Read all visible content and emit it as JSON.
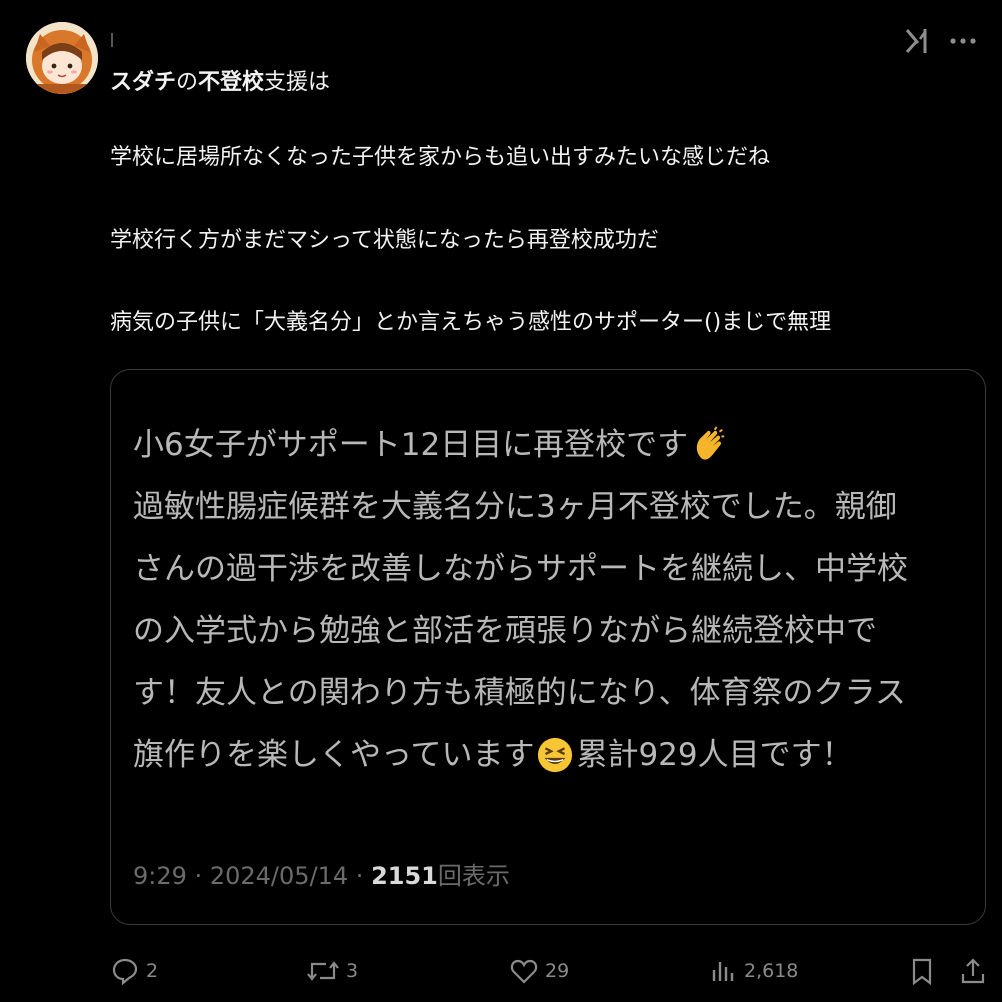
{
  "author": {
    "name_parts": [
      "スダチ",
      "の",
      "不登校",
      "支援は"
    ]
  },
  "post": {
    "lines": [
      "学校に居場所なくなった子供を家からも追い出すみたいな感じだね",
      "学校行く方がまだマシって状態になったら再登校成功だ",
      "病気の子供に「大義名分」とか言えちゃう感性のサポーター()まじで無理"
    ]
  },
  "quote": {
    "lines": [
      {
        "text": "小6女子がサポート12日目に再登校です",
        "emoji_after": "clapping-hands-emoji"
      },
      {
        "text": "過敏性腸症候群を大義名分に3ヶ月不登校でした。親御"
      },
      {
        "text": "さんの過干渉を改善しながらサポートを継続し、中学校"
      },
      {
        "text": "の入学式から勉強と部活を頑張りながら継続登校中で"
      },
      {
        "text": "す！友人との関わり方も積極的になり、体育祭のクラス"
      },
      {
        "text_before": "旗作りを楽しくやっています",
        "emoji": "grinning-squinting-face-emoji",
        "text_after": "累計929人目です！"
      }
    ],
    "meta": {
      "time": "9:29",
      "separator": "·",
      "date": "2024/05/14",
      "views_count": "2151",
      "views_label": "回表示"
    }
  },
  "actions": {
    "replies": "2",
    "reposts": "3",
    "likes": "29",
    "views": "2,618"
  },
  "icons": {
    "grok": "grok-icon",
    "more": "more-icon",
    "reply": "reply-icon",
    "repost": "repost-icon",
    "like": "like-icon",
    "views": "views-icon",
    "bookmark": "bookmark-icon",
    "share": "share-icon"
  },
  "colors": {
    "background": "#000000",
    "text": "#f2f2f2",
    "quote_text": "#b8b8b8",
    "muted": "#8b8b8b",
    "border": "#3a3a3a"
  }
}
